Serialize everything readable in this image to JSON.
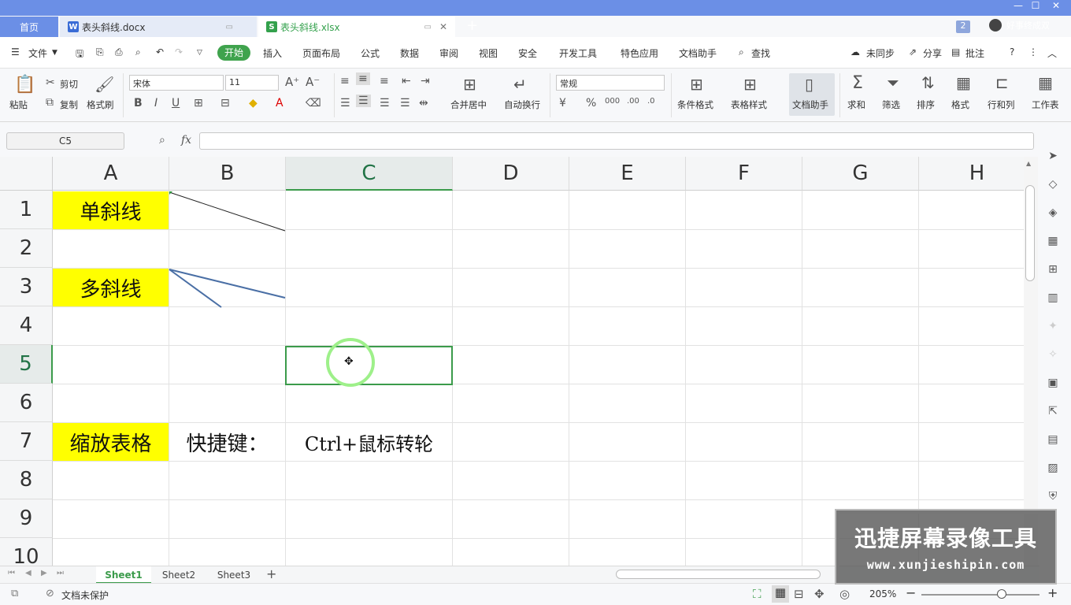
{
  "tabs": {
    "home": "首页",
    "doc": "表头斜线.docx",
    "xls": "表头斜线.xlsx",
    "new": "+",
    "win_count": "2",
    "user": "好事终成双"
  },
  "menu": {
    "file": "文件",
    "start": "开始",
    "insert": "插入",
    "layout": "页面布局",
    "formula": "公式",
    "data": "数据",
    "review": "审阅",
    "view": "视图",
    "security": "安全",
    "dev": "开发工具",
    "special": "特色应用",
    "docasst": "文档助手",
    "find": "查找",
    "unsync": "未同步",
    "share": "分享",
    "comment": "批注"
  },
  "ribbon": {
    "paste": "粘贴",
    "cut": "剪切",
    "copy": "复制",
    "format_painter": "格式刷",
    "font": "宋体",
    "size": "11",
    "merge": "合并居中",
    "wrap": "自动换行",
    "numfmt": "常规",
    "cond_fmt": "条件格式",
    "table_style": "表格样式",
    "doc_assistant": "文档助手",
    "sum": "求和",
    "filter": "筛选",
    "sort": "排序",
    "format": "格式",
    "rowcol": "行和列",
    "worksheet": "工作表"
  },
  "formula_bar": {
    "name_box": "C5",
    "fx": "fx"
  },
  "columns": [
    "A",
    "B",
    "C",
    "D",
    "E",
    "F",
    "G",
    "H"
  ],
  "rows": [
    "1",
    "2",
    "3",
    "4",
    "5",
    "6",
    "7",
    "8",
    "9",
    "10"
  ],
  "cells": {
    "A1": "单斜线",
    "A3": "多斜线",
    "A7": "缩放表格",
    "B7": "快捷键：",
    "C7": "Ctrl+鼠标转轮"
  },
  "sheets": [
    "Sheet1",
    "Sheet2",
    "Sheet3"
  ],
  "status": {
    "protect": "文档未保护",
    "zoom": "205%"
  },
  "watermark": {
    "title": "迅捷屏幕录像工具",
    "url": "www.xunjieshipin.com"
  },
  "colors": {
    "accent": "#3b9b4b",
    "yellow": "#ffff00",
    "tabbar": "#6b8fe6"
  }
}
